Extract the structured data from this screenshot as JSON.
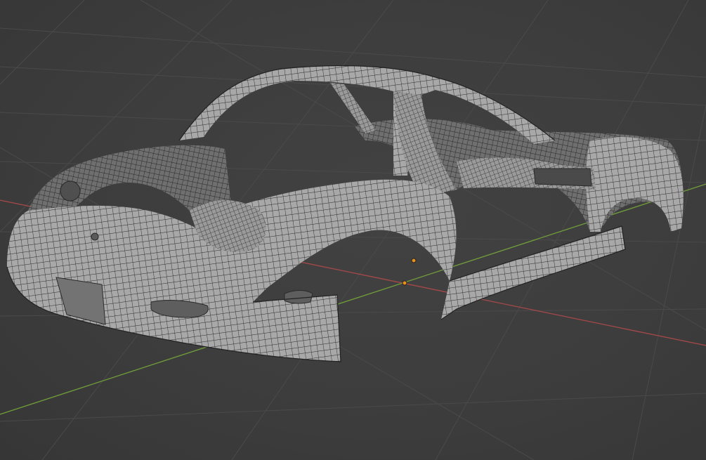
{
  "viewport": {
    "background": "#3d3d3d",
    "grid_color": "#4a4a4a",
    "x_axis_color": "#a04848",
    "y_axis_color": "#6e9a3a",
    "mesh_fill": "#a9a9a9",
    "mesh_shadow": "#7c7c7c",
    "wire_color": "#2a2a2a",
    "origin_color": "#e8901a"
  },
  "scene": {
    "object": "car-body-mesh",
    "shading": "solid-with-wireframe"
  },
  "gizmos": {
    "object_origin_icon": "origin-dot",
    "cursor_icon": "origin-dot"
  }
}
